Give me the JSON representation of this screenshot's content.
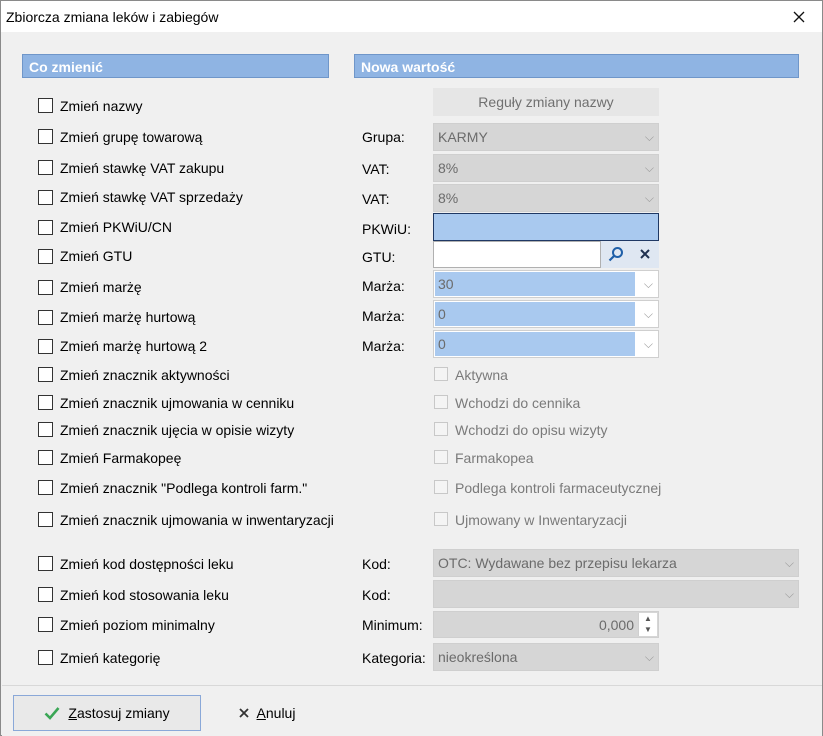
{
  "window": {
    "title": "Zbiorcza zmiana leków i zabiegów",
    "close_icon": "close-icon"
  },
  "headers": {
    "left": "Co zmienić",
    "right": "Nowa wartość"
  },
  "rows": [
    {
      "check": "Zmień nazwy",
      "label": "",
      "value": "Reguły zmiany nazwy"
    },
    {
      "check": "Zmień grupę towarową",
      "label": "Grupa:",
      "value": "KARMY"
    },
    {
      "check": "Zmień stawkę VAT zakupu",
      "label": "VAT:",
      "value": "8%"
    },
    {
      "check": "Zmień stawkę VAT sprzedaży",
      "label": "VAT:",
      "value": "8%"
    },
    {
      "check": "Zmień PKWiU/CN",
      "label": "PKWiU:",
      "value": ""
    },
    {
      "check": "Zmień GTU",
      "label": "GTU:",
      "value": ""
    },
    {
      "check": "Zmień marżę",
      "label": "Marża:",
      "value": "30"
    },
    {
      "check": "Zmień marżę hurtową",
      "label": "Marża:",
      "value": "0"
    },
    {
      "check": "Zmień marżę hurtową 2",
      "label": "Marża:",
      "value": "0"
    },
    {
      "check": "Zmień znacznik aktywności",
      "label": "",
      "value": "Aktywna"
    },
    {
      "check": "Zmień znacznik ujmowania w cenniku",
      "label": "",
      "value": "Wchodzi do cennika"
    },
    {
      "check": "Zmień znacznik ujęcia w opisie wizyty",
      "label": "",
      "value": "Wchodzi do opisu wizyty"
    },
    {
      "check": "Zmień Farmakopeę",
      "label": "",
      "value": "Farmakopea"
    },
    {
      "check": "Zmień znacznik \"Podlega kontroli farm.\"",
      "label": "",
      "value": "Podlega kontroli farmaceutycznej"
    },
    {
      "check": "Zmień znacznik ujmowania w inwentaryzacji",
      "label": "",
      "value": "Ujmowany w Inwentaryzacji"
    },
    {
      "check": "Zmień kod dostępności leku",
      "label": "Kod:",
      "value": "OTC: Wydawane bez przepisu lekarza"
    },
    {
      "check": "Zmień kod stosowania leku",
      "label": "Kod:",
      "value": ""
    },
    {
      "check": "Zmień poziom minimalny",
      "label": "Minimum:",
      "value": "0,000"
    },
    {
      "check": "Zmień kategorię",
      "label": "Kategoria:",
      "value": "nieokreślona"
    }
  ],
  "footer": {
    "apply_prefix": "Z",
    "apply_rest": "astosuj zmiany",
    "cancel_prefix": "A",
    "cancel_rest": "nuluj"
  },
  "colors": {
    "header": "#8fb4e3",
    "field_blue": "#a9c9ef",
    "apply_check": "#3aa655"
  }
}
